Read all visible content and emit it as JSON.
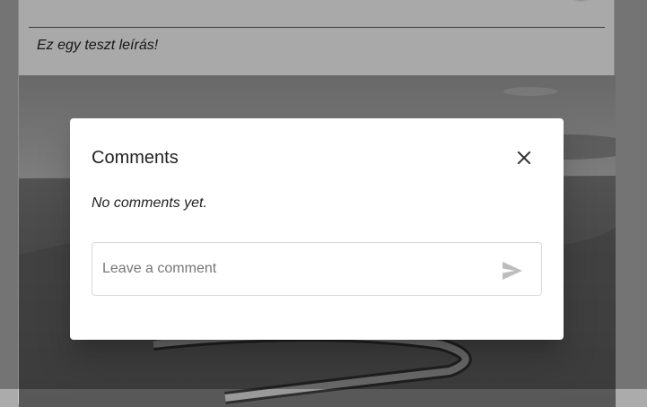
{
  "card": {
    "description": "Ez egy teszt leírás!"
  },
  "dialog": {
    "title": "Comments",
    "empty_message": "No comments yet.",
    "comment_input": {
      "value": "",
      "placeholder": "Leave a comment"
    },
    "close_icon": "close-icon",
    "send_icon": "send-icon"
  },
  "colors": {
    "overlay": "#00000052",
    "dialog_bg": "#ffffff",
    "send_icon": "#bdbdbd",
    "close_icon": "#333333"
  }
}
